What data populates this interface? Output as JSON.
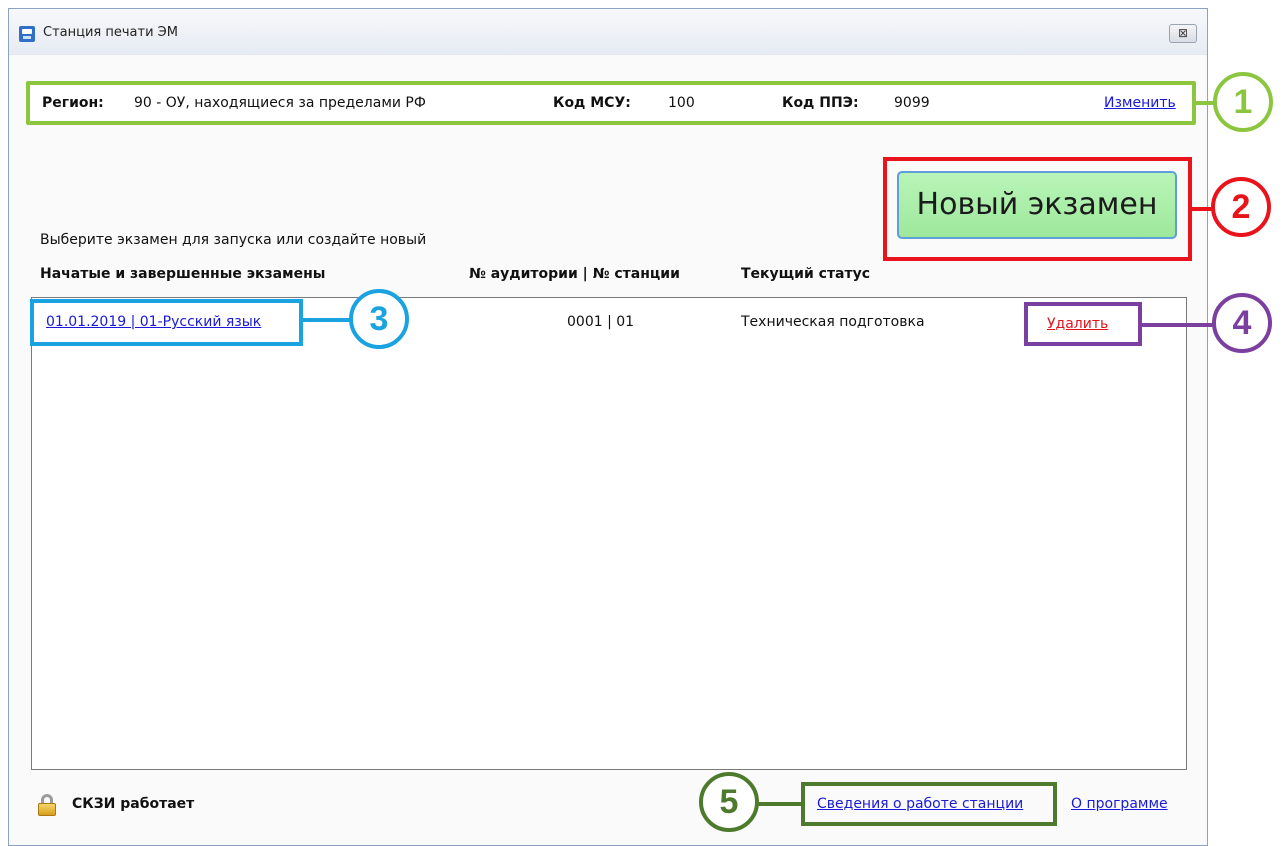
{
  "window": {
    "title": "Станция печати ЭМ",
    "close_glyph": "⊠"
  },
  "info": {
    "region_label": "Регион:",
    "region_value": "90 - ОУ, находящиеся за пределами РФ",
    "msu_label": "Код МСУ:",
    "msu_value": "100",
    "ppe_label": "Код ППЭ:",
    "ppe_value": "9099",
    "change_link": "Изменить"
  },
  "main": {
    "prompt": "Выберите экзамен для запуска или создайте новый",
    "new_exam_button": "Новый экзамен",
    "columns": {
      "exams": "Начатые и завершенные экзамены",
      "room_station": "№ аудитории | № станции",
      "status": "Текущий статус"
    },
    "rows": [
      {
        "exam": "01.01.2019 | 01-Русский язык",
        "room_station": "0001 | 01",
        "status": "Техническая подготовка",
        "delete": "Удалить"
      }
    ]
  },
  "footer": {
    "skzi_status": "СКЗИ работает",
    "station_info_link": "Сведения о работе станции",
    "about_link": "О программе"
  },
  "callouts": {
    "c1": "1",
    "c2": "2",
    "c3": "3",
    "c4": "4",
    "c5": "5"
  },
  "colors": {
    "callout1": "#8cc63f",
    "callout2": "#e8131b",
    "callout3": "#1aa3e0",
    "callout4": "#7b3fa0",
    "callout5": "#4d7a2c",
    "link": "#1a1ad8",
    "delete_link": "#e1141c",
    "new_exam_button_bg": "#a8eea6"
  }
}
